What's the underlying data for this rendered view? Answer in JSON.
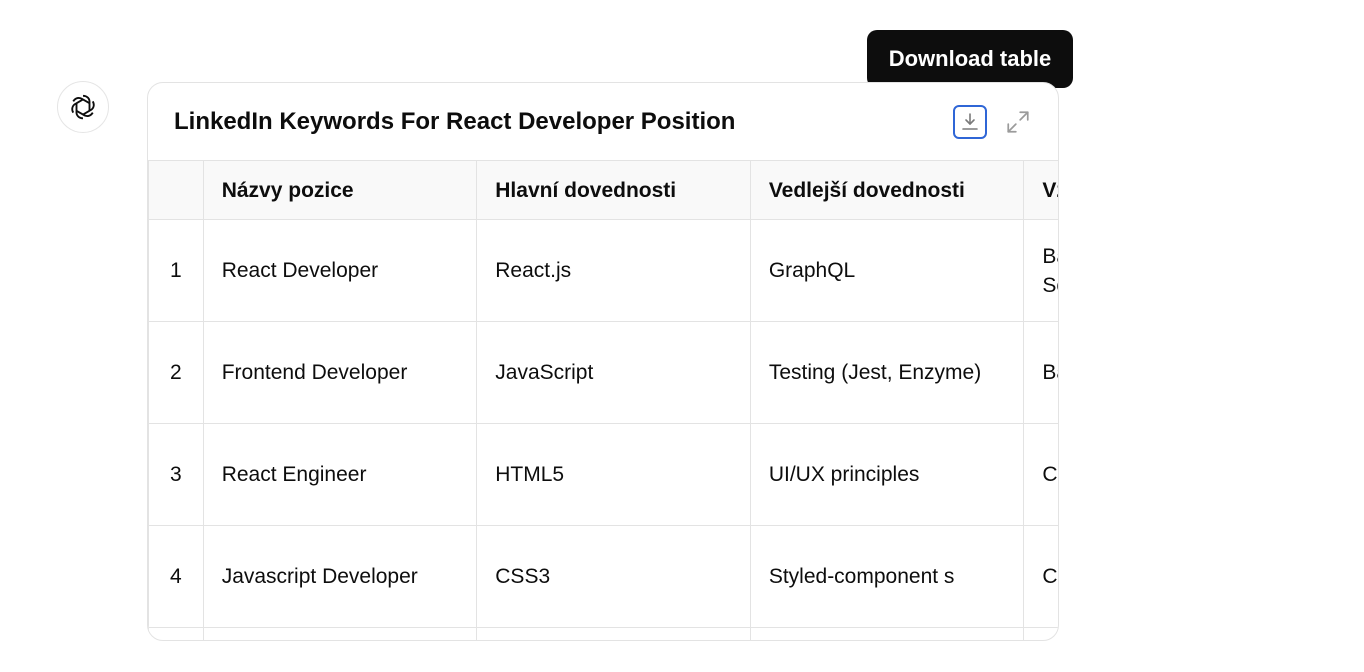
{
  "tooltip": {
    "text": "Download table"
  },
  "card": {
    "title": "LinkedIn Keywords For React Developer Position",
    "download_icon": "download-icon",
    "expand_icon": "expand-icon"
  },
  "table": {
    "headers": [
      "",
      "Názvy pozice",
      "Hlavní dovednosti",
      "Vedlejší dovednosti",
      "Vzdělání a k"
    ],
    "rows": [
      [
        "1",
        "React Developer",
        "React.js",
        "GraphQL",
        "Bachelor’s D in Computer Science"
      ],
      [
        "2",
        "Frontend Developer",
        "JavaScript",
        "Testing (Jest, Enzyme)",
        "Bachelor’s D in IT"
      ],
      [
        "3",
        "React Engineer",
        "HTML5",
        "UI/UX principles",
        "Certification React"
      ],
      [
        "4",
        "Javascript Developer",
        "CSS3",
        "Styled-component s",
        "Certification JavaScript"
      ]
    ]
  }
}
